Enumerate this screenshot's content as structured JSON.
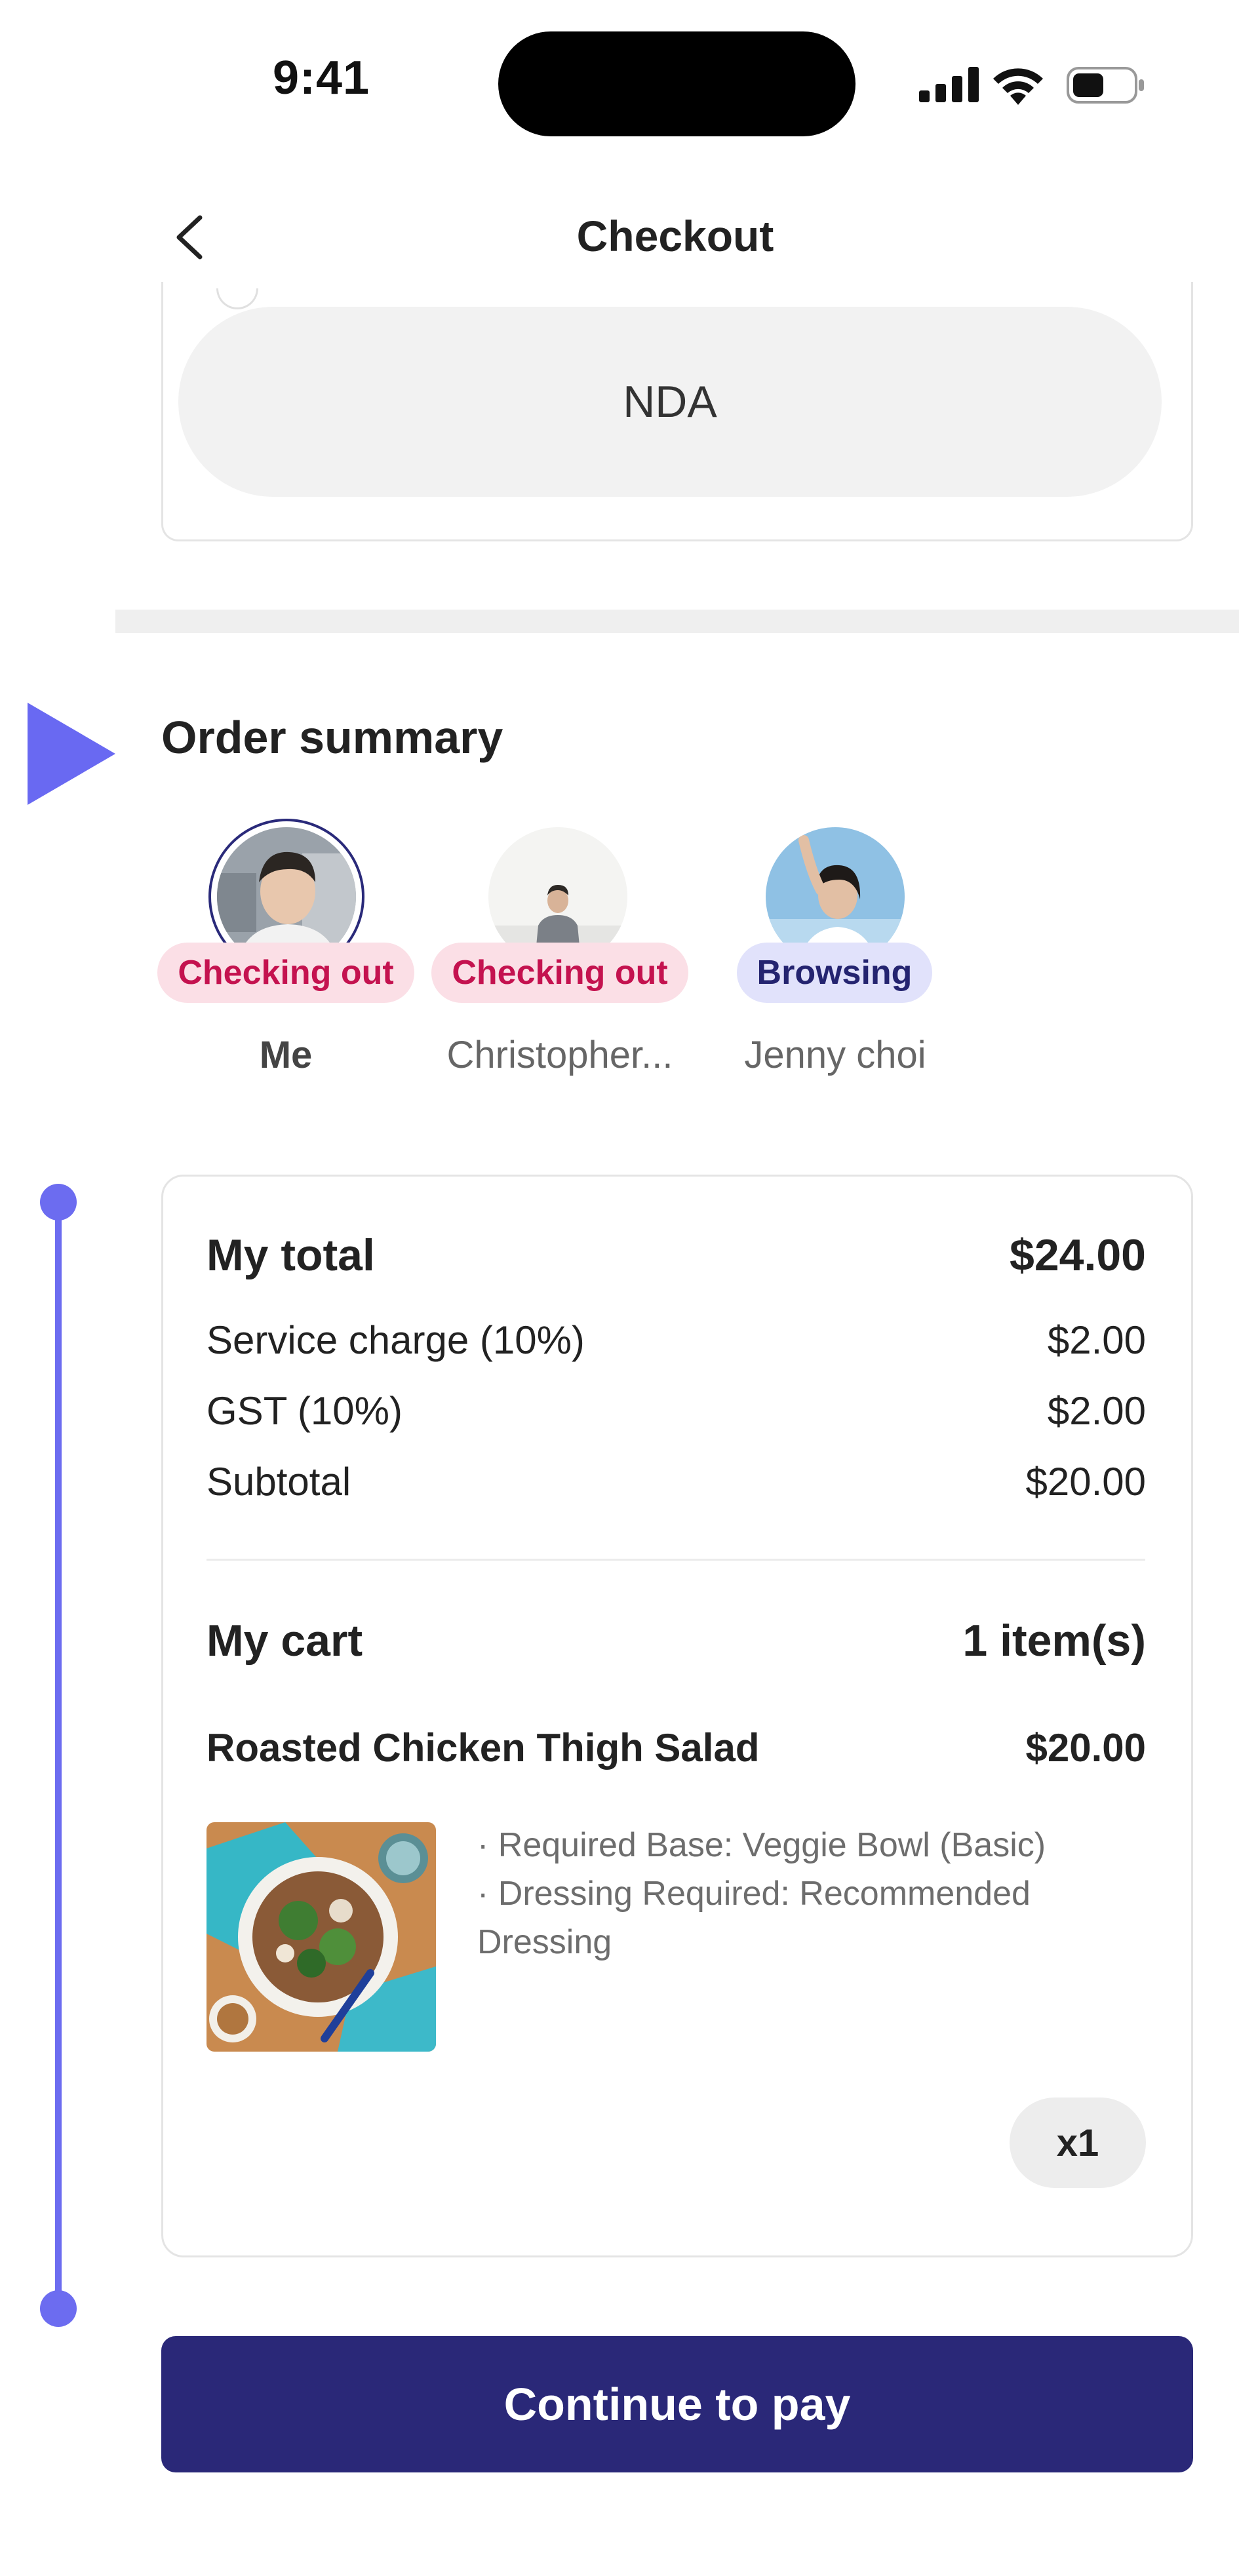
{
  "status_bar": {
    "time": "9:41",
    "icons": [
      "cellular-signal-icon",
      "wifi-icon",
      "battery-icon"
    ]
  },
  "header": {
    "title": "Checkout",
    "back_icon": "chevron-left-icon"
  },
  "nda_option": {
    "label": "NDA"
  },
  "order_summary": {
    "title": "Order summary",
    "participants": [
      {
        "name": "Me",
        "status": "Checking out",
        "avatar": "avatar-me"
      },
      {
        "name": "Christopher...",
        "status": "Checking out",
        "avatar": "avatar-christopher"
      },
      {
        "name": "Jenny choi",
        "status": "Browsing",
        "avatar": "avatar-jenny"
      }
    ]
  },
  "totals": {
    "my_total_label": "My total",
    "my_total_value": "$24.00",
    "rows": [
      {
        "label": "Service charge (10%)",
        "value": "$2.00"
      },
      {
        "label": "GST (10%)",
        "value": "$2.00"
      },
      {
        "label": "Subtotal",
        "value": "$20.00"
      }
    ]
  },
  "cart": {
    "title": "My cart",
    "count": "1 item(s)",
    "item": {
      "name": "Roasted Chicken Thigh Salad",
      "price": "$20.00",
      "options": [
        "· Required Base: Veggie Bowl (Basic)",
        "· Dressing Required: Recommended Dressing"
      ],
      "quantity": "x1"
    }
  },
  "cta": {
    "label": "Continue to pay"
  },
  "colors": {
    "accent": "#6c6cf0",
    "primary": "#2a2878",
    "checking_out_bg": "#fbdfe6",
    "checking_out_text": "#c4124f",
    "browsing_bg": "#e1e2fb"
  }
}
